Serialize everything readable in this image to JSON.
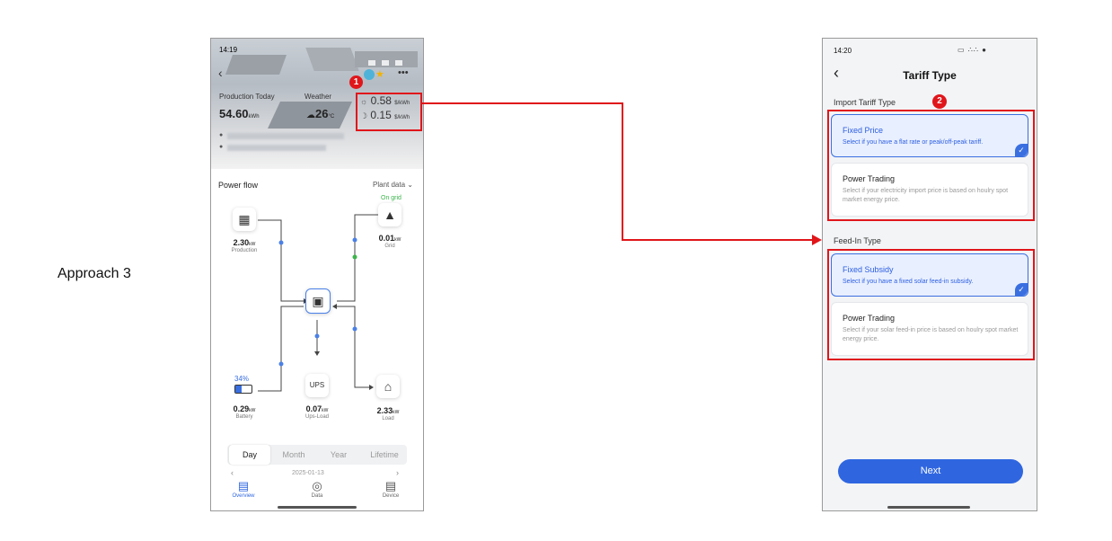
{
  "approach_label": "Approach 3",
  "left_screen": {
    "status_time": "14:19",
    "production_label": "Production Today",
    "production_value": "54.60",
    "production_unit": "kWh",
    "weather_label": "Weather",
    "weather_value": "26",
    "weather_unit": "°C",
    "price_peak": "0.58",
    "price_offpeak": "0.15",
    "price_unit": "$/kWh",
    "badge_number": "1",
    "power_flow_title": "Power flow",
    "plant_data_label": "Plant data",
    "on_grid_label": "On grid",
    "nodes": {
      "production": {
        "value": "2.30",
        "unit": "kW",
        "label": "Production"
      },
      "grid": {
        "value": "0.01",
        "unit": "kW",
        "label": "Grid"
      },
      "battery": {
        "percent": "34%",
        "value": "0.29",
        "unit": "kW",
        "label": "Battery"
      },
      "ups": {
        "value": "0.07",
        "unit": "kW",
        "label": "Ups-Load"
      },
      "load": {
        "value": "2.33",
        "unit": "kW",
        "label": "Load"
      }
    },
    "period_tabs": [
      "Day",
      "Month",
      "Year",
      "Lifetime"
    ],
    "active_tab": "Day",
    "date_text": "2025-01-13",
    "bottom_nav": [
      "Overview",
      "Data",
      "Device"
    ]
  },
  "right_screen": {
    "status_time": "14:20",
    "title": "Tariff Type",
    "badge_number": "2",
    "import_section": "Import Tariff Type",
    "import_options": [
      {
        "title": "Fixed Price",
        "desc": "Select if you have a flat rate or peak/off-peak tariff.",
        "selected": true
      },
      {
        "title": "Power Trading",
        "desc": "Select if your electricity import price is based on houlry spot market energy price.",
        "selected": false
      }
    ],
    "feedin_section": "Feed-In Type",
    "feedin_options": [
      {
        "title": "Fixed Subsidy",
        "desc": "Select if you have a fixed solar feed-in subsidy.",
        "selected": true
      },
      {
        "title": "Power Trading",
        "desc": "Select if your solar feed-in price is based on houlry spot market energy price.",
        "selected": false
      }
    ],
    "next_label": "Next"
  },
  "colors": {
    "highlight": "#e0161b",
    "accent": "#2f66e0",
    "on_grid": "#3bb54a"
  }
}
